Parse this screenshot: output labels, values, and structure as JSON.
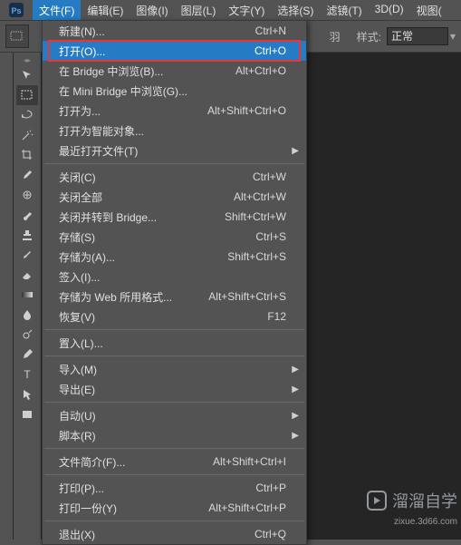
{
  "menubar": {
    "items": [
      {
        "label": "文件(F)",
        "active": true
      },
      {
        "label": "编辑(E)"
      },
      {
        "label": "图像(I)"
      },
      {
        "label": "图层(L)"
      },
      {
        "label": "文字(Y)"
      },
      {
        "label": "选择(S)"
      },
      {
        "label": "滤镜(T)"
      },
      {
        "label": "3D(D)"
      },
      {
        "label": "视图("
      }
    ]
  },
  "options": {
    "feather": "羽",
    "style_label": "样式:",
    "style_value": "正常"
  },
  "dropdown": {
    "groups": [
      [
        {
          "label": "新建(N)...",
          "shortcut": "Ctrl+N"
        },
        {
          "label": "打开(O)...",
          "shortcut": "Ctrl+O",
          "highlight": true,
          "redbox": true
        },
        {
          "label": "在 Bridge 中浏览(B)...",
          "shortcut": "Alt+Ctrl+O"
        },
        {
          "label": "在 Mini Bridge 中浏览(G)..."
        },
        {
          "label": "打开为...",
          "shortcut": "Alt+Shift+Ctrl+O"
        },
        {
          "label": "打开为智能对象..."
        },
        {
          "label": "最近打开文件(T)",
          "submenu": true
        }
      ],
      [
        {
          "label": "关闭(C)",
          "shortcut": "Ctrl+W"
        },
        {
          "label": "关闭全部",
          "shortcut": "Alt+Ctrl+W"
        },
        {
          "label": "关闭并转到 Bridge...",
          "shortcut": "Shift+Ctrl+W"
        },
        {
          "label": "存储(S)",
          "shortcut": "Ctrl+S"
        },
        {
          "label": "存储为(A)...",
          "shortcut": "Shift+Ctrl+S"
        },
        {
          "label": "签入(I)..."
        },
        {
          "label": "存储为 Web 所用格式...",
          "shortcut": "Alt+Shift+Ctrl+S"
        },
        {
          "label": "恢复(V)",
          "shortcut": "F12"
        }
      ],
      [
        {
          "label": "置入(L)..."
        }
      ],
      [
        {
          "label": "导入(M)",
          "submenu": true
        },
        {
          "label": "导出(E)",
          "submenu": true
        }
      ],
      [
        {
          "label": "自动(U)",
          "submenu": true
        },
        {
          "label": "脚本(R)",
          "submenu": true
        }
      ],
      [
        {
          "label": "文件简介(F)...",
          "shortcut": "Alt+Shift+Ctrl+I"
        }
      ],
      [
        {
          "label": "打印(P)...",
          "shortcut": "Ctrl+P"
        },
        {
          "label": "打印一份(Y)",
          "shortcut": "Alt+Shift+Ctrl+P"
        }
      ],
      [
        {
          "label": "退出(X)",
          "shortcut": "Ctrl+Q"
        }
      ]
    ]
  },
  "tools": [
    "move",
    "marquee",
    "lasso",
    "wand",
    "crop",
    "eyedropper",
    "healing",
    "brush",
    "stamp",
    "history",
    "eraser",
    "gradient",
    "blur",
    "dodge",
    "pen",
    "type",
    "path-select",
    "rectangle"
  ],
  "watermark": {
    "brand": "溜溜自学",
    "url": "zixue.3d66.com"
  }
}
